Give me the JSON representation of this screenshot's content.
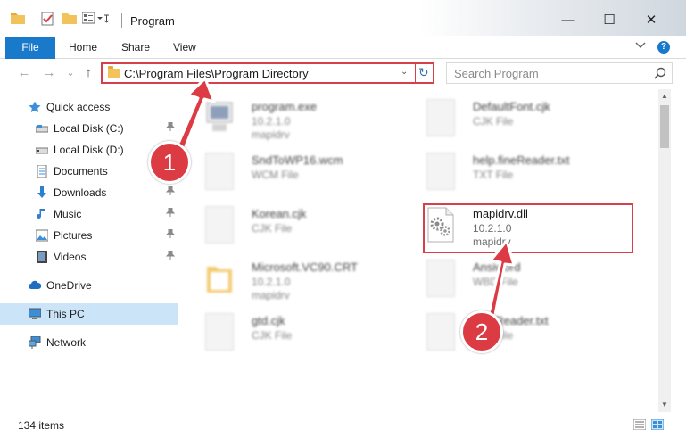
{
  "window": {
    "title": "Program",
    "minimize": "—",
    "maximize": "☐",
    "close": "✕"
  },
  "ribbon": {
    "tabs": [
      "File",
      "Home",
      "Share",
      "View"
    ],
    "expand_icon": "chevron-down-icon",
    "help_label": "?"
  },
  "nav": {
    "back_icon": "←",
    "forward_icon": "→",
    "recent_icon": "⌄",
    "up_icon": "↑",
    "address": "C:\\Program Files\\Program Directory",
    "address_dropdown": "⌄",
    "refresh_icon": "↻",
    "search_placeholder": "Search Program"
  },
  "sidebar": {
    "items": [
      {
        "label": "Quick access",
        "icon": "star-icon",
        "pinned": false
      },
      {
        "label": "Local Disk (C:)",
        "icon": "drive-icon",
        "pinned": true
      },
      {
        "label": "Local Disk (D:)",
        "icon": "drive-icon",
        "pinned": false
      },
      {
        "label": "Documents",
        "icon": "documents-icon",
        "pinned": true
      },
      {
        "label": "Downloads",
        "icon": "download-icon",
        "pinned": true
      },
      {
        "label": "Music",
        "icon": "music-icon",
        "pinned": true
      },
      {
        "label": "Pictures",
        "icon": "pictures-icon",
        "pinned": true
      },
      {
        "label": "Videos",
        "icon": "videos-icon",
        "pinned": true
      },
      {
        "label": "OneDrive",
        "icon": "cloud-icon",
        "pinned": false
      },
      {
        "label": "This PC",
        "icon": "computer-icon",
        "pinned": false,
        "selected": true
      },
      {
        "label": "Network",
        "icon": "network-icon",
        "pinned": false
      }
    ],
    "pin_glyph": "📌"
  },
  "files": [
    {
      "name": "program.exe",
      "type": "10.2.1.0",
      "extra": "mapidrv"
    },
    {
      "name": "DefaultFont.cjk",
      "type": "CJK File",
      "extra": ""
    },
    {
      "name": "SndToWP16.wcm",
      "type": "WCM File",
      "extra": ""
    },
    {
      "name": "help.fineReader.txt",
      "type": "TXT File",
      "extra": ""
    },
    {
      "name": "Korean.cjk",
      "type": "CJK File",
      "extra": ""
    },
    {
      "name": "mapidrv.dll",
      "type": "10.2.1.0",
      "extra": "mapidrv"
    },
    {
      "name": "Microsoft.VC90.CRT",
      "type": "10.2.1.0",
      "extra": "mapidrv"
    },
    {
      "name": "Ansiword",
      "type": "WBD File",
      "extra": ""
    },
    {
      "name": "gtd.cjk",
      "type": "CJK File",
      "extra": ""
    },
    {
      "name": "FineReader.txt",
      "type": "TXT File",
      "extra": ""
    }
  ],
  "status": {
    "item_count": "134 items"
  },
  "annotations": {
    "step1": "1",
    "step2": "2",
    "color": "#dd3b44"
  }
}
